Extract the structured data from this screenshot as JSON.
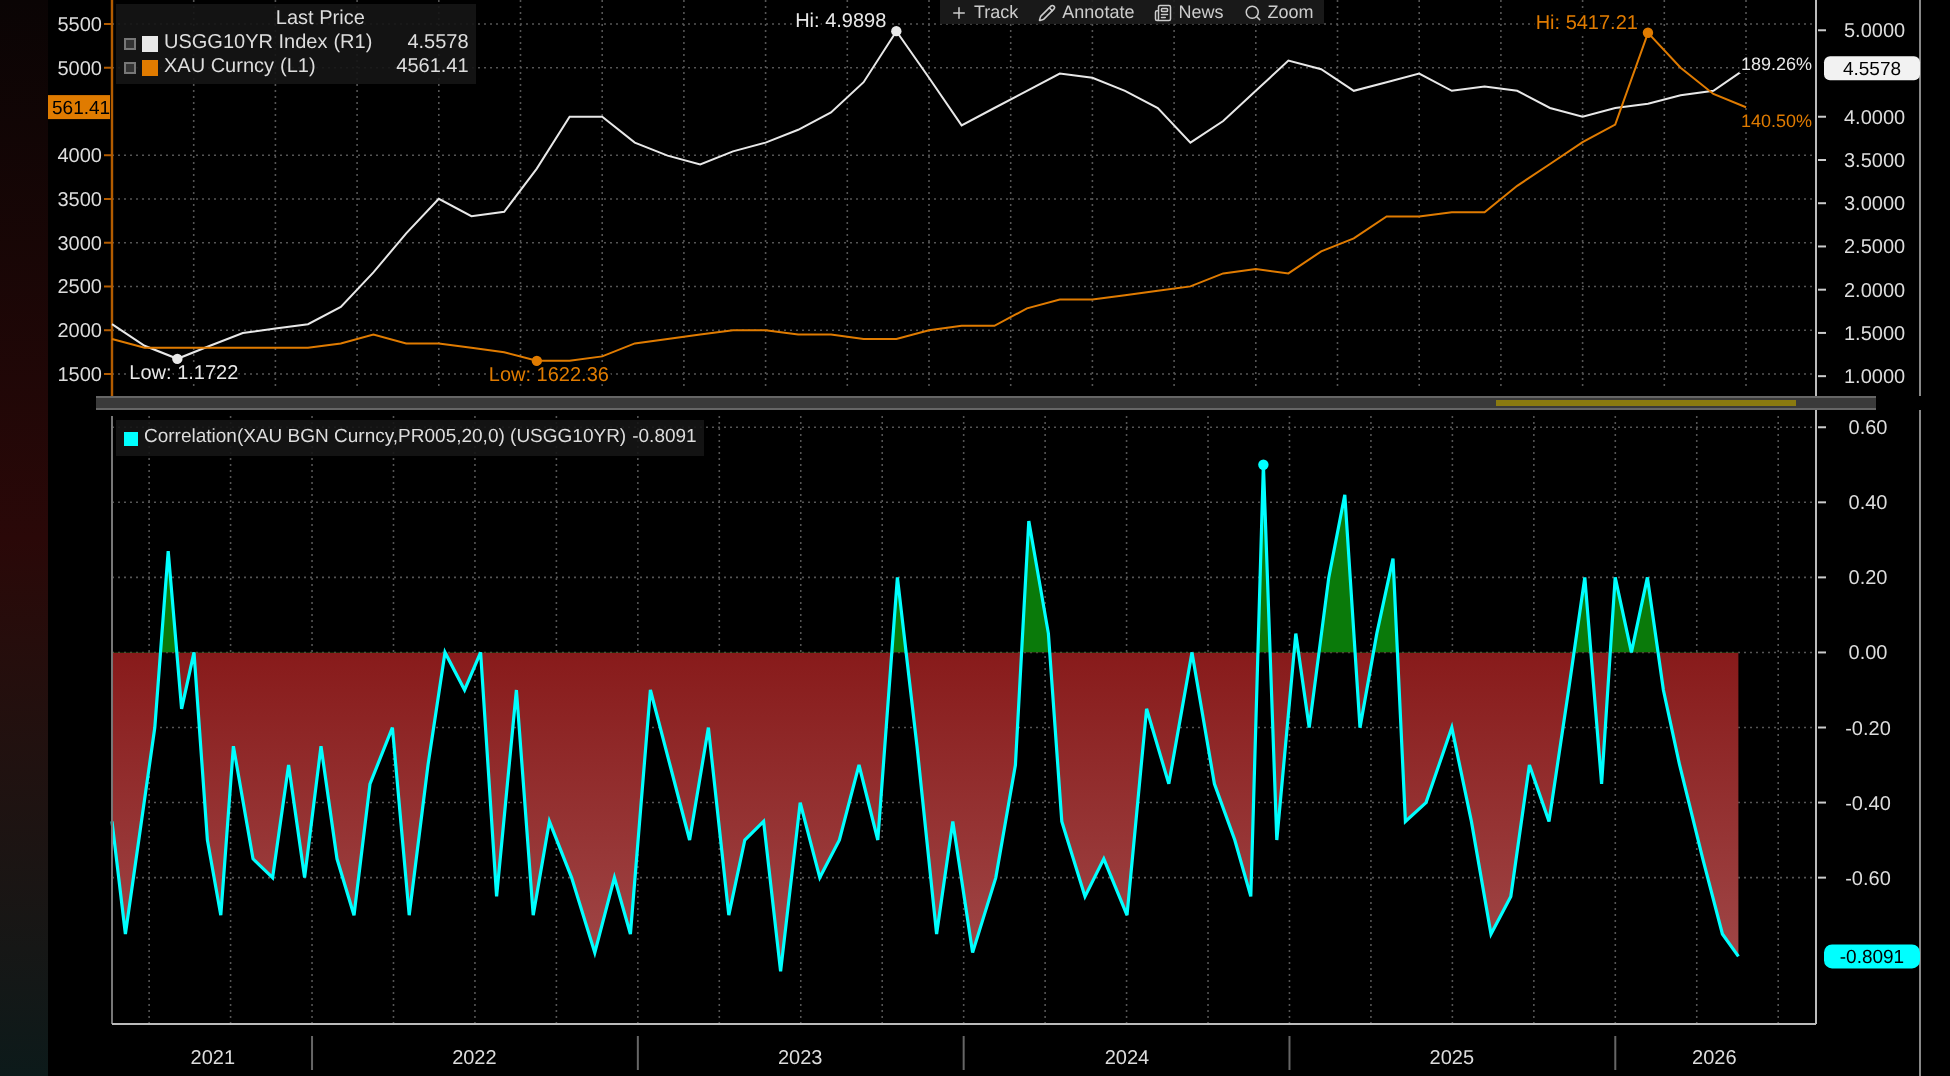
{
  "toolbar": [
    {
      "label": "Track",
      "kind": "crosshair"
    },
    {
      "label": "Annotate",
      "kind": "pencil"
    },
    {
      "label": "News",
      "kind": "news"
    },
    {
      "label": "Zoom",
      "kind": "search"
    }
  ],
  "price_chart": {
    "legend": {
      "title": "Last Price",
      "rows": [
        {
          "tag": "(R1)",
          "value": "4.5578"
        },
        {
          "tag": "(L1)",
          "value": "4561.41"
        }
      ]
    },
    "left_flag": "561.41",
    "right_flag": "4.5578",
    "change_labels": [
      "189.26%",
      "140.50%"
    ],
    "chart_data": {
      "type": "line",
      "grid": true,
      "ylim": [
        1317,
        5774
      ],
      "y2lim": [
        0.84,
        5.35
      ],
      "yticks": [
        {
          "value": 1500,
          "label": "1500"
        },
        {
          "value": 2000,
          "label": "2000"
        },
        {
          "value": 2500,
          "label": "2500"
        },
        {
          "value": 3000,
          "label": "3000"
        },
        {
          "value": 3500,
          "label": "3500"
        },
        {
          "value": 4000,
          "label": "4000"
        },
        {
          "value": 5000,
          "label": "5000"
        },
        {
          "value": 5500,
          "label": "5500"
        }
      ],
      "y2ticks": [
        {
          "value": 1,
          "label": "1.0000"
        },
        {
          "value": 1.5,
          "label": "1.5000"
        },
        {
          "value": 2,
          "label": "2.0000"
        },
        {
          "value": 2.5,
          "label": "2.5000"
        },
        {
          "value": 3,
          "label": "3.0000"
        },
        {
          "value": 3.5,
          "label": "3.5000"
        },
        {
          "value": 4,
          "label": "4.0000"
        },
        {
          "value": 5,
          "label": "5.0000"
        }
      ],
      "categories": [
        null,
        null,
        null,
        null,
        null,
        null,
        null,
        null,
        null,
        null,
        null,
        null,
        null,
        null,
        null,
        null,
        null,
        null,
        null,
        null,
        null,
        null,
        null,
        null,
        null,
        null,
        null,
        null,
        null,
        null,
        null,
        null,
        null,
        null,
        null,
        null,
        null,
        null,
        null,
        null,
        null,
        null,
        null,
        null,
        null,
        null,
        null,
        null,
        null,
        null,
        null
      ],
      "series": [
        {
          "name": "USGG10YR Index",
          "color": "#e8e8e8",
          "axis": "y2",
          "values": [
            1.6,
            1.35,
            1.2,
            1.35,
            1.5,
            1.55,
            1.6,
            1.8,
            2.2,
            2.65,
            3.05,
            2.85,
            2.9,
            3.4,
            4.0,
            4.0,
            3.7,
            3.55,
            3.45,
            3.6,
            3.7,
            3.85,
            4.05,
            4.4,
            4.99,
            4.45,
            3.9,
            4.1,
            4.3,
            4.5,
            4.45,
            4.3,
            4.1,
            3.7,
            3.95,
            4.3,
            4.65,
            4.55,
            4.3,
            4.4,
            4.5,
            4.3,
            4.35,
            4.3,
            4.1,
            4.0,
            4.1,
            4.15,
            4.25,
            4.3,
            4.56
          ]
        },
        {
          "name": "XAU Curncy",
          "color": "#e07b00",
          "values": [
            1900,
            1800,
            1800,
            1800,
            1800,
            1800,
            1800,
            1850,
            1950,
            1850,
            1850,
            1800,
            1750,
            1650,
            1650,
            1700,
            1850,
            1900,
            1950,
            2000,
            2000,
            1950,
            1950,
            1900,
            1900,
            2000,
            2050,
            2050,
            2250,
            2350,
            2350,
            2400,
            2450,
            2500,
            2650,
            2700,
            2650,
            2900,
            3050,
            3300,
            3300,
            3350,
            3350,
            3650,
            3900,
            4150,
            4350,
            5400,
            5000,
            4700,
            4550
          ]
        }
      ],
      "annotations": [
        "Low: 1.1722",
        "Low: 1622.36",
        "Hi: 4.9898",
        "Hi: 5417.21"
      ]
    }
  },
  "correlation_chart": {
    "legend": {
      "value": "-0.8091"
    },
    "flag": "-0.8091",
    "chart_data": {
      "type": "area",
      "grid": true,
      "xlim": [
        "2021-05-22",
        "2026-08-14"
      ],
      "ylim": [
        -0.99,
        0.63
      ],
      "yticks": [
        {
          "value": 0.6,
          "label": "0.60"
        },
        {
          "value": 0.4,
          "label": "0.40"
        },
        {
          "value": 0.2,
          "label": "0.20"
        },
        {
          "value": 0,
          "label": "0.00"
        },
        {
          "value": -0.2,
          "label": "-0.20"
        },
        {
          "value": -0.4,
          "label": "-0.40"
        },
        {
          "value": -0.6,
          "label": "-0.60"
        }
      ],
      "xticks": [
        {
          "value": "2021-09-12",
          "label": "2021"
        },
        {
          "value": "2022-07-02",
          "label": "2022"
        },
        {
          "value": "2023-07-02",
          "label": "2023"
        },
        {
          "value": "2024-07-02",
          "label": "2024"
        },
        {
          "value": "2025-07-02",
          "label": "2025"
        },
        {
          "value": "2026-04-22",
          "label": "2026"
        }
      ],
      "x": [
        "2021-05-22",
        "2021-06-06",
        "2021-06-21",
        "2021-07-09",
        "2021-07-24",
        "2021-08-08",
        "2021-08-22",
        "2021-09-06",
        "2021-09-21",
        "2021-10-05",
        "2021-10-27",
        "2021-11-18",
        "2021-12-06",
        "2021-12-24",
        "2022-01-11",
        "2022-01-29",
        "2022-02-17",
        "2022-03-07",
        "2022-04-01",
        "2022-04-20",
        "2022-05-11",
        "2022-05-30",
        "2022-06-21",
        "2022-07-09",
        "2022-07-27",
        "2022-08-18",
        "2022-09-06",
        "2022-09-24",
        "2022-10-19",
        "2022-11-14",
        "2022-12-06",
        "2022-12-24",
        "2023-01-15",
        "2023-02-06",
        "2023-02-28",
        "2023-03-21",
        "2023-04-13",
        "2023-05-01",
        "2023-05-22",
        "2023-06-10",
        "2023-07-02",
        "2023-07-24",
        "2023-08-15",
        "2023-09-06",
        "2023-09-27",
        "2023-10-19",
        "2023-11-10",
        "2023-12-02",
        "2023-12-20",
        "2024-01-11",
        "2024-02-06",
        "2024-02-28",
        "2024-03-14",
        "2024-04-05",
        "2024-04-20",
        "2024-05-16",
        "2024-06-06",
        "2024-07-02",
        "2024-07-24",
        "2024-08-18",
        "2024-09-13",
        "2024-10-08",
        "2024-10-31",
        "2024-11-18",
        "2024-12-02",
        "2024-12-17",
        "2025-01-08",
        "2025-01-23",
        "2025-02-14",
        "2025-03-04",
        "2025-03-21",
        "2025-04-09",
        "2025-04-27",
        "2025-05-11",
        "2025-06-03",
        "2025-07-02",
        "2025-07-24",
        "2025-08-15",
        "2025-09-06",
        "2025-09-27",
        "2025-10-19",
        "2025-11-10",
        "2025-11-28",
        "2025-12-17",
        "2026-01-01",
        "2026-01-19",
        "2026-02-06",
        "2026-02-24",
        "2026-03-14",
        "2026-04-09",
        "2026-05-01",
        "2026-05-19"
      ],
      "series": [
        {
          "name": "Correlation(XAU BGN Curncy,PR005,20,0) (USGG10YR)",
          "color": "#00ffff",
          "values": [
            -0.45,
            -0.75,
            -0.5,
            -0.2,
            0.27,
            -0.15,
            0.0,
            -0.5,
            -0.7,
            -0.25,
            -0.55,
            -0.6,
            -0.3,
            -0.6,
            -0.25,
            -0.55,
            -0.7,
            -0.35,
            -0.2,
            -0.7,
            -0.3,
            0.0,
            -0.1,
            0.0,
            -0.65,
            -0.1,
            -0.7,
            -0.45,
            -0.6,
            -0.8,
            -0.6,
            -0.75,
            -0.1,
            -0.3,
            -0.5,
            -0.2,
            -0.7,
            -0.5,
            -0.45,
            -0.85,
            -0.4,
            -0.6,
            -0.5,
            -0.3,
            -0.5,
            0.2,
            -0.25,
            -0.75,
            -0.45,
            -0.8,
            -0.6,
            -0.3,
            0.35,
            0.05,
            -0.45,
            -0.65,
            -0.55,
            -0.7,
            -0.15,
            -0.35,
            0.0,
            -0.35,
            -0.5,
            -0.65,
            0.5,
            -0.5,
            0.05,
            -0.2,
            0.2,
            0.42,
            -0.2,
            0.05,
            0.25,
            -0.45,
            -0.4,
            -0.2,
            -0.45,
            -0.75,
            -0.65,
            -0.3,
            -0.45,
            -0.1,
            0.2,
            -0.35,
            0.2,
            0.0,
            0.2,
            -0.1,
            -0.3,
            -0.55,
            -0.75,
            -0.81
          ]
        }
      ]
    }
  }
}
